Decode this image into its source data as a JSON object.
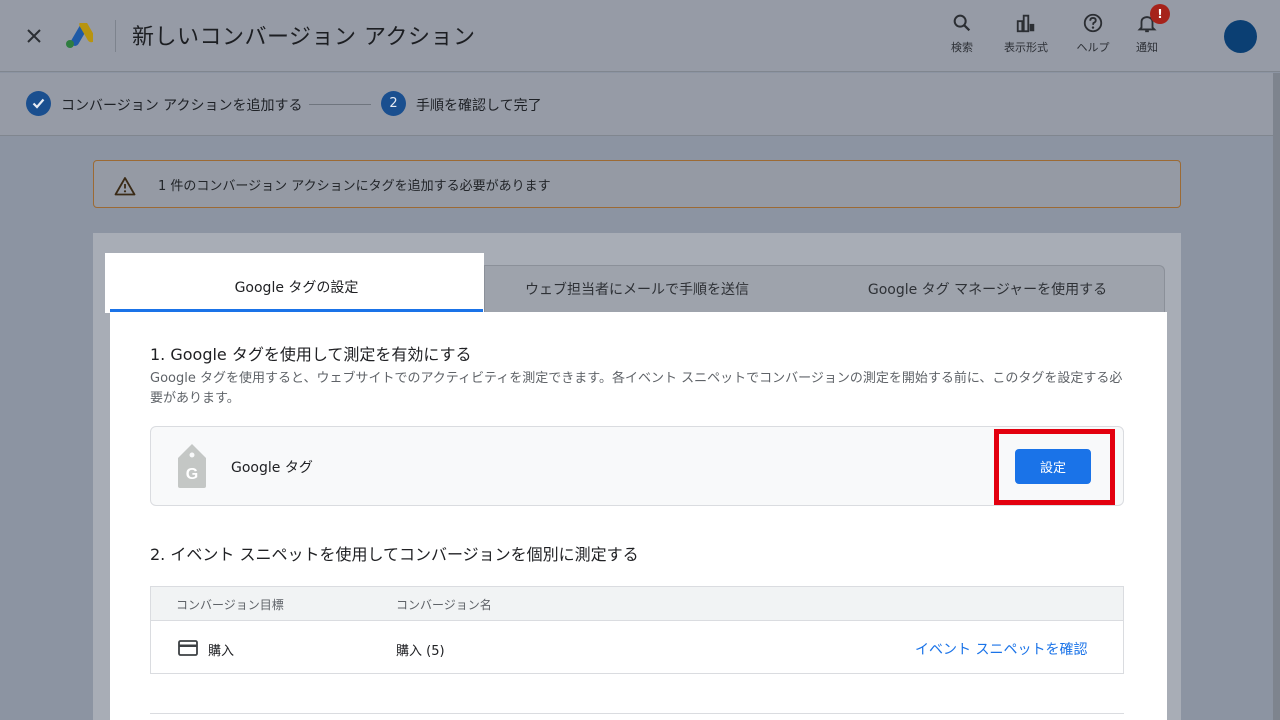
{
  "header": {
    "title": "新しいコンバージョン アクション",
    "tools": [
      {
        "icon": "search-icon",
        "label": "検索"
      },
      {
        "icon": "view-icon",
        "label": "表示形式"
      },
      {
        "icon": "help-icon",
        "label": "ヘルプ"
      },
      {
        "icon": "bell-icon",
        "label": "通知",
        "badge": "!"
      }
    ]
  },
  "stepper": {
    "step1": {
      "label": "コンバージョン アクションを追加する",
      "status": "done"
    },
    "step2": {
      "number": "2",
      "label": "手順を確認して完了"
    }
  },
  "warning": {
    "text": "1 件のコンバージョン アクションにタグを追加する必要があります"
  },
  "tabs": [
    {
      "label": "Google タグの設定",
      "active": true
    },
    {
      "label": "ウェブ担当者にメールで手順を送信",
      "active": false
    },
    {
      "label": "Google タグ マネージャーを使用する",
      "active": false
    }
  ],
  "section1": {
    "title": "1. Google タグを使用して測定を有効にする",
    "description": "Google タグを使用すると、ウェブサイトでのアクティビティを測定できます。各イベント スニペットでコンバージョンの測定を開始する前に、このタグを設定する必要があります。",
    "tag_name": "Google タグ",
    "button_label": "設定"
  },
  "section2": {
    "title": "2. イベント スニペットを使用してコンバージョンを個別に測定する",
    "columns": [
      "コンバージョン目標",
      "コンバージョン名"
    ],
    "rows": [
      {
        "goal": "購入",
        "name": "購入 (5)",
        "action": "イベント スニペットを確認"
      }
    ]
  },
  "colors": {
    "accent": "#1a73e8",
    "highlight": "#e3000f",
    "warning_border": "#9c6a34"
  }
}
